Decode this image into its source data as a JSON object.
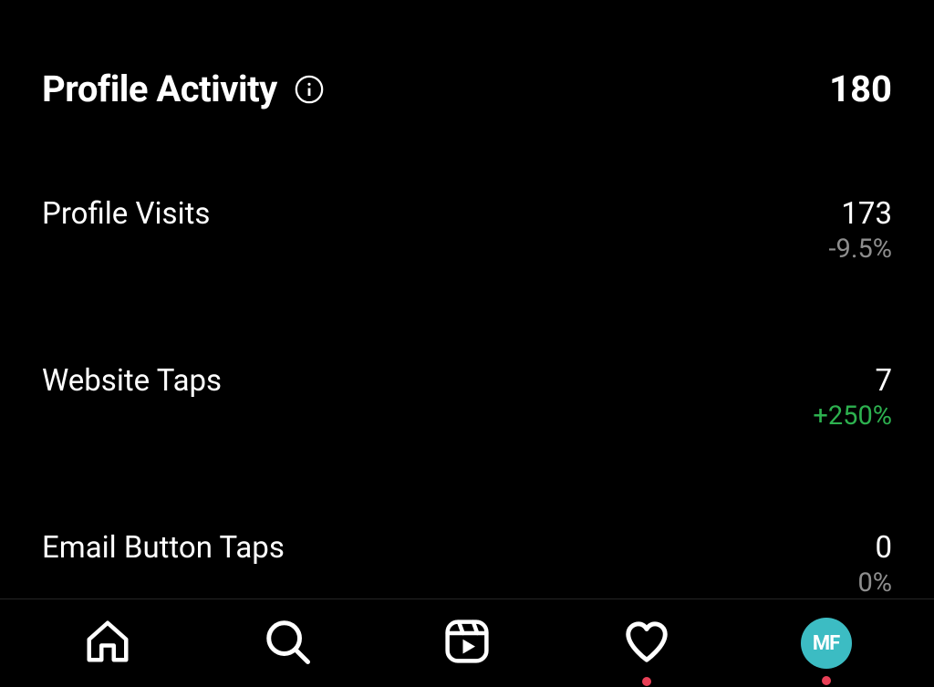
{
  "header": {
    "title": "Profile Activity",
    "value": "180"
  },
  "metrics": [
    {
      "label": "Profile Visits",
      "value": "173",
      "change": "-9.5%",
      "changeType": "gray"
    },
    {
      "label": "Website Taps",
      "value": "7",
      "change": "+250%",
      "changeType": "green"
    },
    {
      "label": "Email Button Taps",
      "value": "0",
      "change": "0%",
      "changeType": "gray"
    }
  ],
  "nav": {
    "avatarInitials": "MF"
  }
}
